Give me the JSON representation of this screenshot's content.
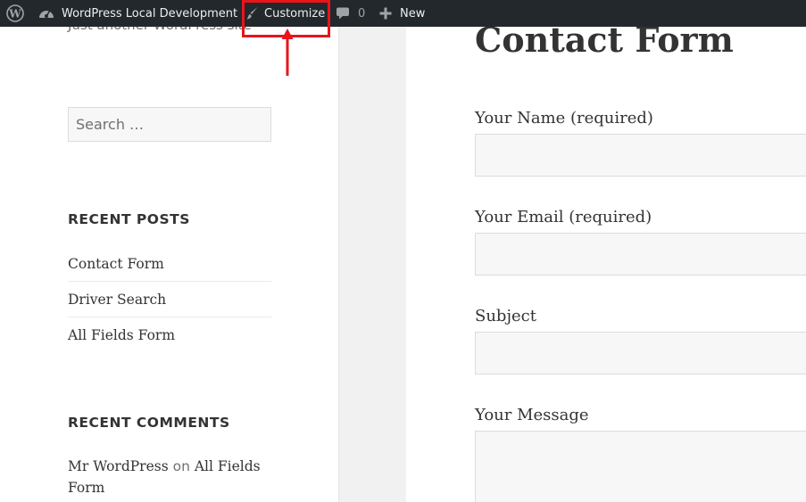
{
  "admin_bar": {
    "site_name": "WordPress Local Development",
    "customize_label": "Customize",
    "comments_count": "0",
    "new_label": "New"
  },
  "sidebar": {
    "site_description": "Just another WordPress site",
    "search_placeholder": "Search …",
    "recent_posts_title": "RECENT POSTS",
    "recent_posts": [
      "Contact Form",
      "Driver Search",
      "All Fields Form"
    ],
    "recent_comments_title": "RECENT COMMENTS",
    "recent_comment": {
      "author": "Mr WordPress",
      "connector": "on",
      "post": "All Fields Form"
    }
  },
  "main": {
    "page_title": "Contact Form",
    "form": {
      "name_label": "Your Name (required)",
      "email_label": "Your Email (required)",
      "subject_label": "Subject",
      "message_label": "Your Message"
    }
  },
  "colors": {
    "admin_bar_bg": "#23282d",
    "highlight": "#e8141a"
  }
}
